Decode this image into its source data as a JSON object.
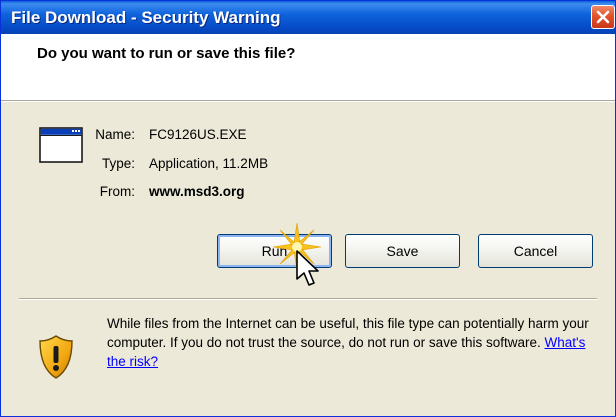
{
  "window": {
    "title": "File Download - Security Warning"
  },
  "question": "Do you want to run or save this file?",
  "file": {
    "name_label": "Name:",
    "name_value": "FC9126US.EXE",
    "type_label": "Type:",
    "type_value": "Application, 11.2MB",
    "from_label": "From:",
    "from_value": "www.msd3.org"
  },
  "buttons": {
    "run": "Run",
    "save": "Save",
    "cancel": "Cancel"
  },
  "warning": {
    "text": "While files from the Internet can be useful, this file type can potentially harm your computer. If you do not trust the source, do not run or save this software.",
    "link": "What's the risk?"
  },
  "colors": {
    "titlebar": "#0a5fd8",
    "dialog_bg": "#ece9d8",
    "link": "#0000ff",
    "close_button": "#e2532a"
  },
  "icons": [
    "close-icon",
    "application-window-icon",
    "security-shield-icon",
    "click-sparkle-icon",
    "mouse-cursor-icon"
  ]
}
